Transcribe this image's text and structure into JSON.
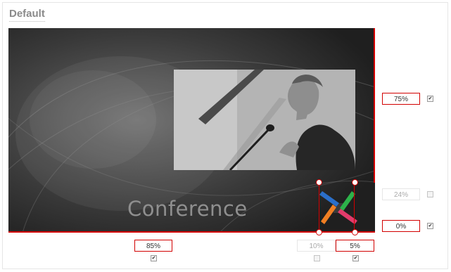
{
  "panel": {
    "title": "Default"
  },
  "stage": {
    "caption": "Conference"
  },
  "controls": {
    "right_top": {
      "value": "75%",
      "checked": true,
      "enabled": true
    },
    "right_middle": {
      "value": "24%",
      "checked": false,
      "enabled": false
    },
    "right_bottom": {
      "value": "0%",
      "checked": true,
      "enabled": true
    },
    "bottom_left": {
      "value": "85%",
      "checked": true,
      "enabled": true
    },
    "bottom_mid": {
      "value": "10%",
      "checked": false,
      "enabled": false
    },
    "bottom_right": {
      "value": "5%",
      "checked": true,
      "enabled": true
    }
  },
  "colors": {
    "accent": "#d20000",
    "stage_bg": "#2d2d2d",
    "caption": "#8f8f8f"
  },
  "icons": {
    "checkbox_checked": "✔"
  }
}
